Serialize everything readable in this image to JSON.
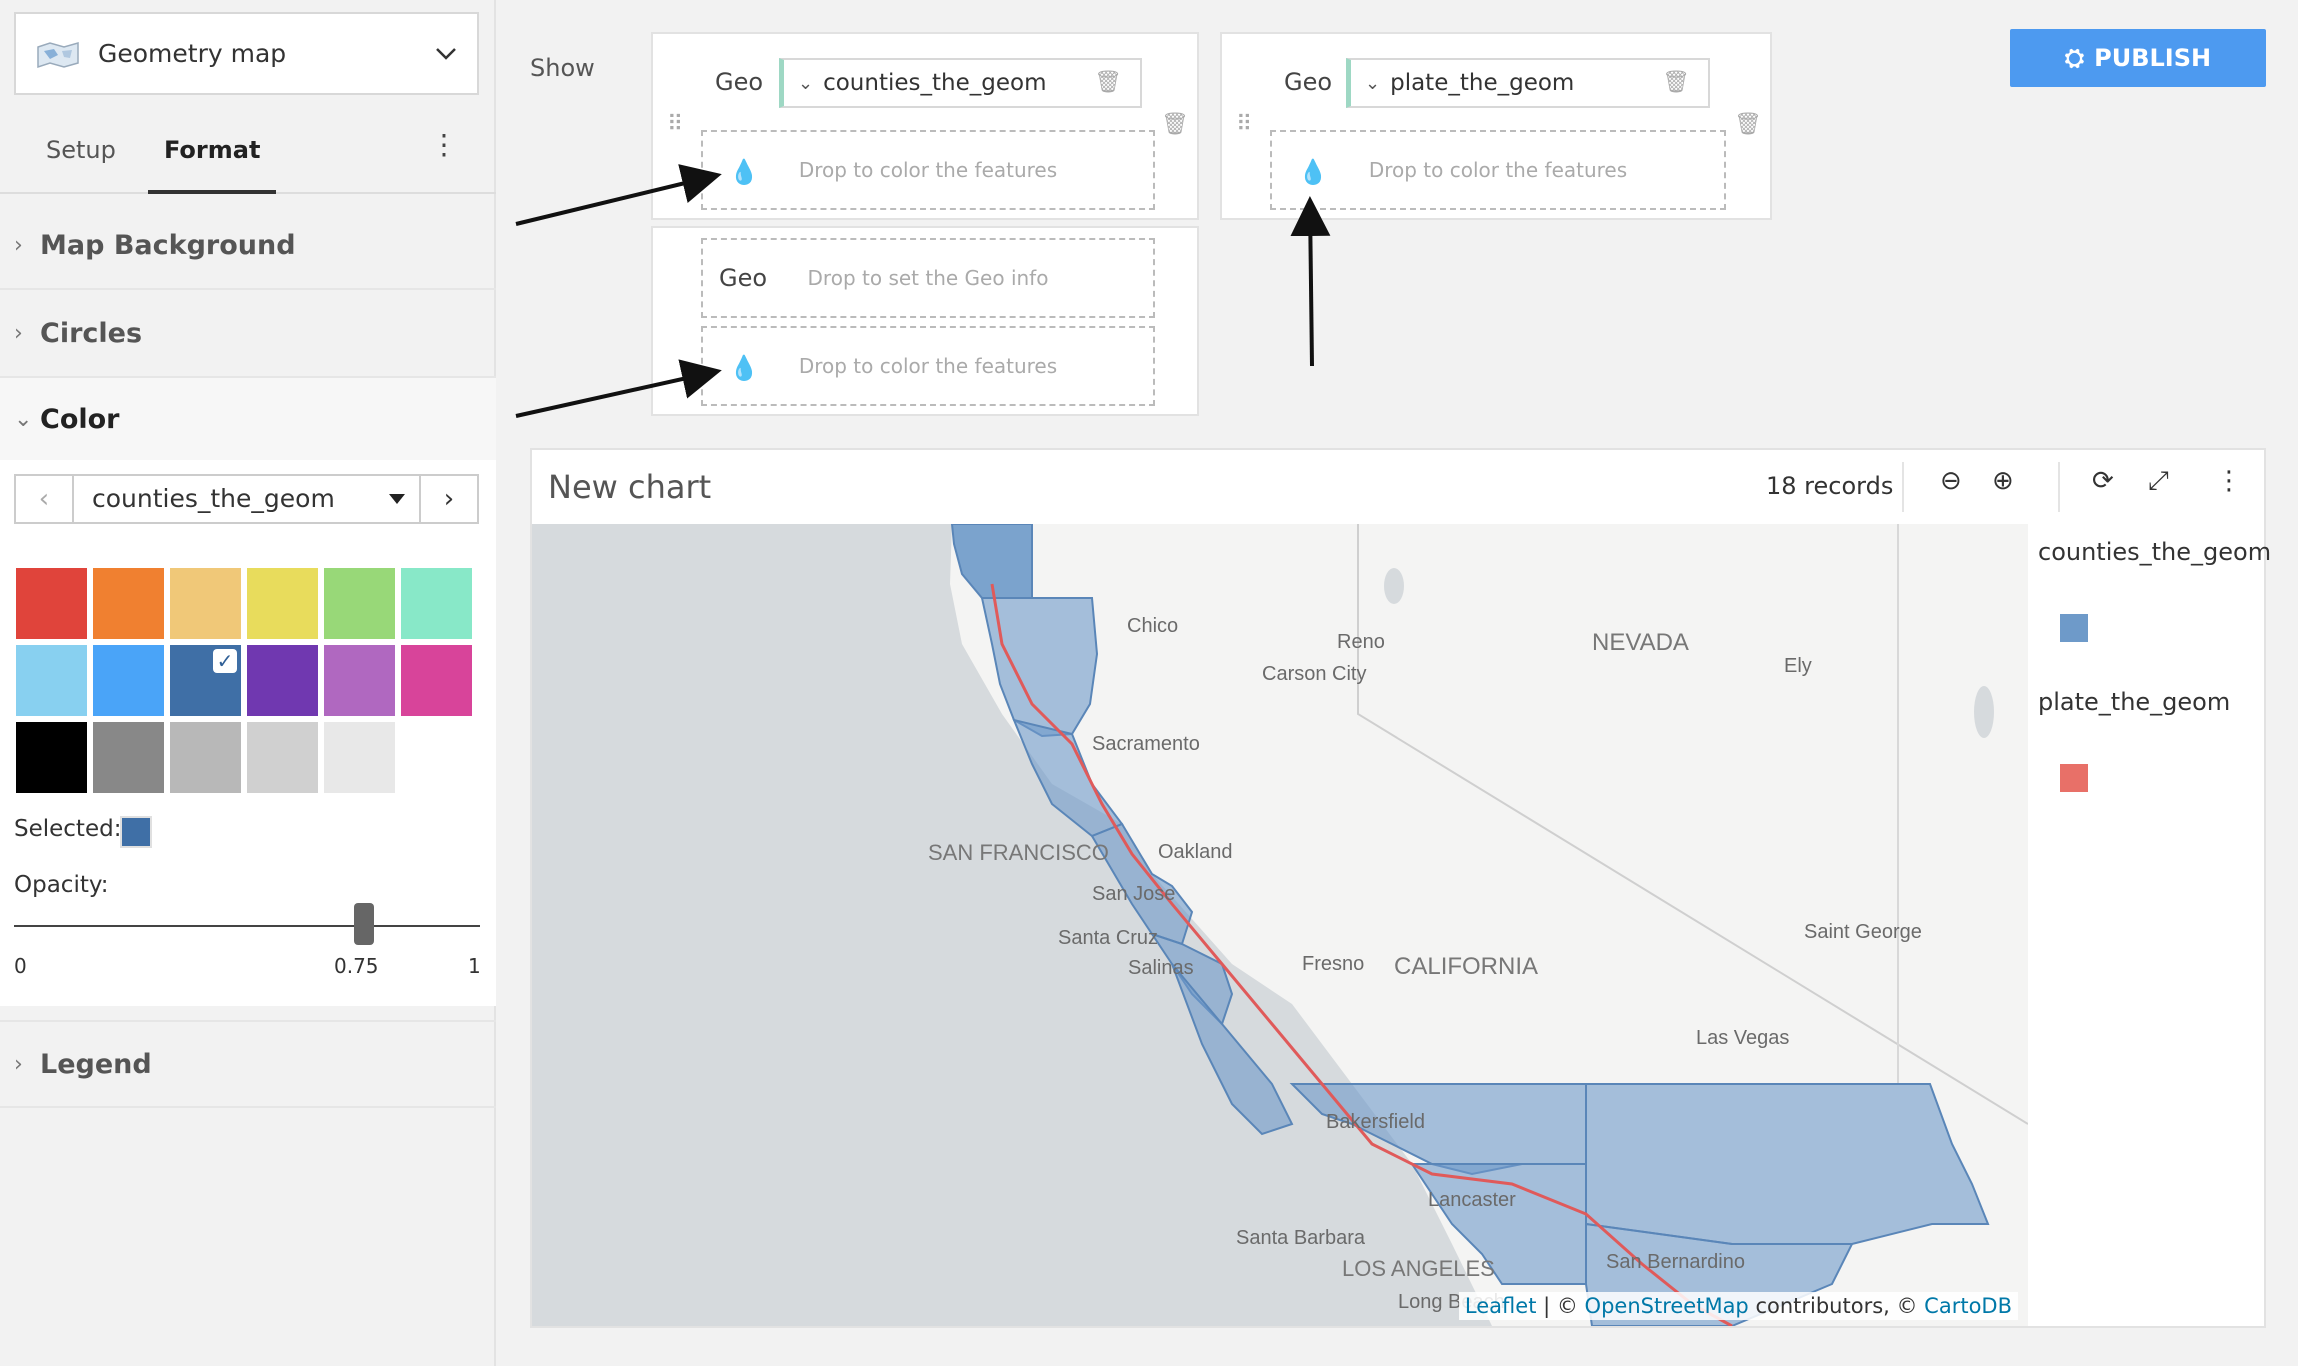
{
  "chart_type": {
    "label": "Geometry map"
  },
  "tabs": [
    {
      "label": "Setup"
    },
    {
      "label": "Format"
    }
  ],
  "sections": {
    "map_background": "Map Background",
    "circles": "Circles",
    "color": "Color",
    "legend": "Legend"
  },
  "color_panel": {
    "selected_layer": "counties_the_geom",
    "swatches": [
      "#e0443b",
      "#f08030",
      "#f0c878",
      "#e8dc5c",
      "#98d878",
      "#88e8c8",
      "#88d0f0",
      "#4aa4f8",
      "#3f6fa6",
      "#7038b0",
      "#b068c0",
      "#d8449a",
      "#000000",
      "#888888",
      "#b8b8b8",
      "#d0d0d0",
      "#e8e8e8"
    ],
    "selected_index": 8,
    "selected_label": "Selected:",
    "selected_color": "#3f6fa6",
    "opacity_label": "Opacity:",
    "opacity_value": 0.75,
    "opacity_min": "0",
    "opacity_mid": "0.75",
    "opacity_max": "1"
  },
  "config": {
    "show_label": "Show",
    "geo_label": "Geo",
    "layer1_field": "counties_the_geom",
    "layer2_field": "plate_the_geom",
    "drop_color": "Drop to color the features",
    "drop_geo": "Drop to set the Geo info"
  },
  "publish_label": "PUBLISH",
  "chart": {
    "title": "New chart",
    "records": "18 records"
  },
  "map_labels": {
    "chico": "Chico",
    "reno": "Reno",
    "nevada": "NEVADA",
    "carson": "Carson City",
    "ely": "Ely",
    "sacramento": "Sacramento",
    "sf": "SAN FRANCISCO",
    "oakland": "Oakland",
    "sanjose": "San Jose",
    "santacruz": "Santa Cruz",
    "salinas": "Salinas",
    "fresno": "Fresno",
    "california": "CALIFORNIA",
    "stgeorge": "Saint George",
    "lasvegas": "Las Vegas",
    "bakersfield": "Bakersfield",
    "lancaster": "Lancaster",
    "santabarbara": "Santa Barbara",
    "la": "LOS ANGELES",
    "sanbern": "San Bernardino",
    "longbeach": "Long Beach"
  },
  "attribution": {
    "leaflet": "Leaflet",
    "sep1": " | © ",
    "osm": "OpenStreetMap",
    "contrib": " contributors, © ",
    "carto": "CartoDB"
  },
  "legend": [
    {
      "name": "counties_the_geom",
      "color": "#6e9ac9"
    },
    {
      "name": "plate_the_geom",
      "color": "#e87068"
    }
  ],
  "colors": {
    "accent": "#4d9af0",
    "county_fill": "#6e9ac9",
    "plate_line": "#e05a5a"
  }
}
